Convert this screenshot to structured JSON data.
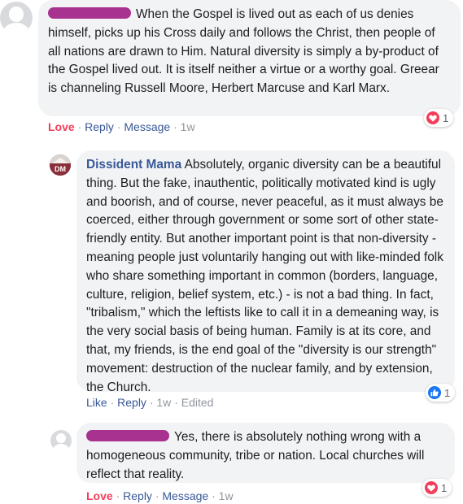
{
  "comments": [
    {
      "text": "When the Gospel is lived out as each of us denies himself, picks up his Cross daily and follows the Christ, then people of all nations are drawn to Him. Natural diversity is simply a by-product of the Gospel lived out. It is itself neither a virtue or a worthy goal. Greear is channeling Russell Moore, Herbert Marcuse and Karl Marx.",
      "actions": {
        "reaction": "Love",
        "reply": "Reply",
        "message": "Message",
        "time": "1w"
      },
      "reactions": {
        "icon": "heart-icon",
        "count": "1"
      }
    },
    {
      "author": "Dissident Mama",
      "text": "Absolutely, organic diversity can be a beautiful thing. But the fake, inauthentic, politically motivated kind is ugly and boorish, and of course, never peaceful, as it must always be coerced, either through government or some sort of other state-friendly entity. But another important point is that non-diversity - meaning people just voluntarily hanging out with like-minded folk who share something important in common (borders, language, culture, religion, belief system, etc.) - is not a bad thing. In fact, \"tribalism,\" which the leftists like to call it in a demeaning way, is the very social basis of being human. Family is at its core, and that, my friends, is the end goal of the \"diversity is our strength\" movement: destruction of the nuclear family, and by extension, the Church.",
      "actions": {
        "like": "Like",
        "reply": "Reply",
        "time": "1w",
        "edited": "Edited"
      },
      "reactions": {
        "icon": "thumbs-up-icon",
        "count": "1"
      }
    },
    {
      "text": "Yes, there is absolutely nothing wrong with a homogeneous community, tribe or nation. Local churches will reflect that reality.",
      "actions": {
        "reaction": "Love",
        "reply": "Reply",
        "message": "Message",
        "time": "1w"
      },
      "reactions": {
        "icon": "heart-icon",
        "count": "1"
      }
    }
  ],
  "avatar_initials": "DM",
  "colors": {
    "link": "#385898",
    "love": "#f33e58",
    "like": "#1877f2",
    "redaction": "#a8328f",
    "bubble": "#f2f3f5"
  }
}
